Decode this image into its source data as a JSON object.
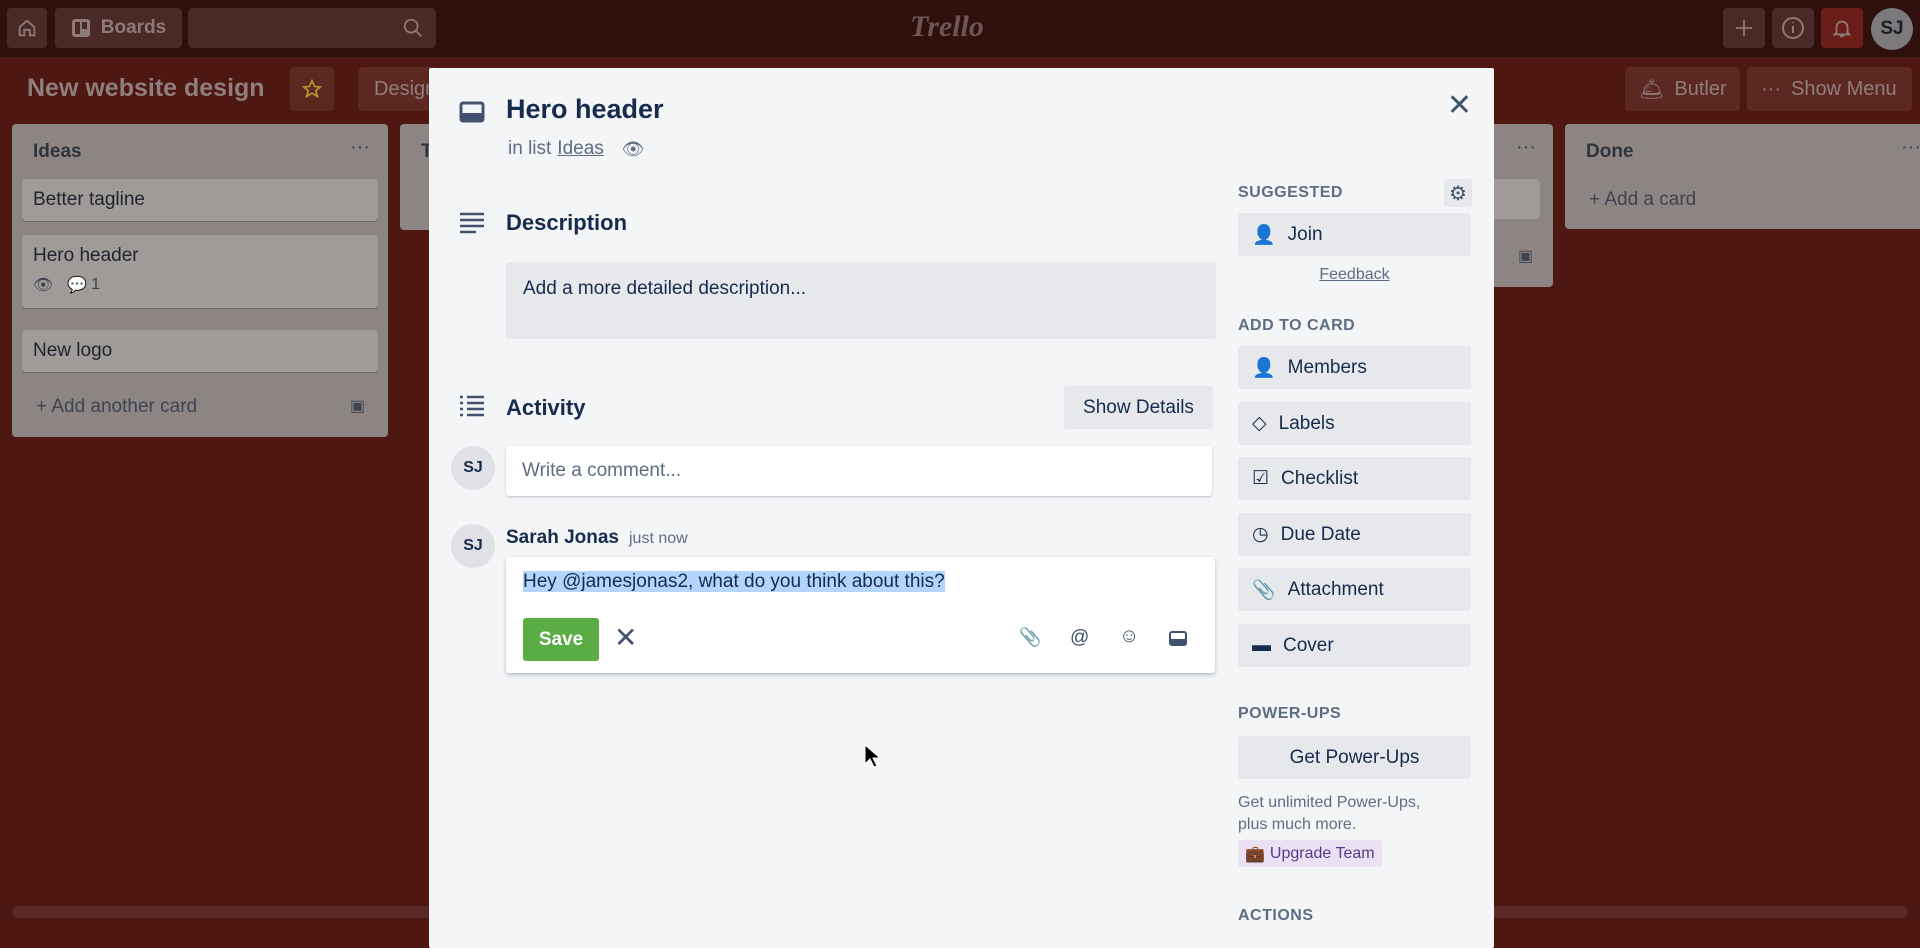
{
  "topbar": {
    "boards_label": "Boards",
    "logo": "Trello",
    "avatar": "SJ",
    "icons": [
      "home-icon",
      "board-icon",
      "search-icon",
      "plus-icon",
      "info-icon",
      "bell-icon"
    ]
  },
  "board": {
    "title": "New website design",
    "tab_partial": "Design",
    "butler_label": "Butler",
    "show_menu_label": "Show Menu"
  },
  "lists": [
    {
      "title": "Ideas",
      "cards": [
        "Better tagline",
        "Hero header",
        "New logo"
      ],
      "hero_comment_count": "1",
      "add_label": "Add another card"
    },
    {
      "title": "T"
    },
    {
      "title": "Done",
      "add_label": "Add a card"
    }
  ],
  "modal": {
    "title": "Hero header",
    "in_list_prefix": "in list",
    "list_name": "Ideas",
    "description_title": "Description",
    "description_placeholder": "Add a more detailed description...",
    "activity_title": "Activity",
    "show_details": "Show Details",
    "comment_placeholder": "Write a comment...",
    "avatar": "SJ",
    "comment": {
      "author": "Sarah Jonas",
      "time": "just now",
      "text": "Hey @jamesjonas2, what do you think about this?",
      "save": "Save"
    },
    "sidebar": {
      "suggested": "SUGGESTED",
      "join": "Join",
      "feedback": "Feedback",
      "add_to_card": "ADD TO CARD",
      "buttons": [
        "Members",
        "Labels",
        "Checklist",
        "Due Date",
        "Attachment",
        "Cover"
      ],
      "power_ups": "POWER-UPS",
      "get_power_ups": "Get Power-Ups",
      "power_ups_desc_1": "Get unlimited Power-Ups,",
      "power_ups_desc_2": "plus much more.",
      "upgrade": "Upgrade Team",
      "actions": "ACTIONS"
    }
  },
  "colors": {
    "save": "#5aac44",
    "selection": "#b3d4fc",
    "upgrade_bg": "#eae1f5",
    "notification": "#8b1a1a"
  }
}
